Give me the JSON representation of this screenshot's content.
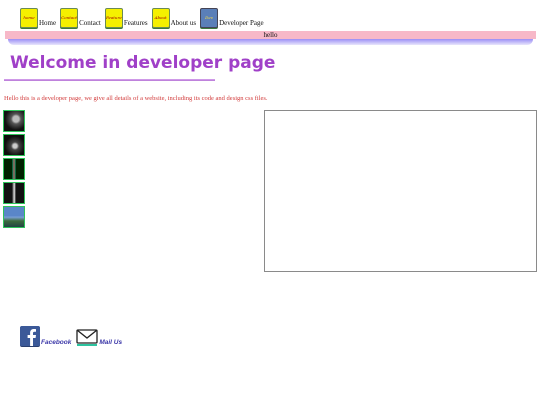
{
  "nav": [
    {
      "icon": "home-icon",
      "icon_text": "home",
      "label": "Home"
    },
    {
      "icon": "contact-icon",
      "icon_text": "Contact",
      "label": "Contact"
    },
    {
      "icon": "features-icon",
      "icon_text": "Feature",
      "label": "Features"
    },
    {
      "icon": "about-icon",
      "icon_text": "About",
      "label": "About us"
    },
    {
      "icon": "developer-icon",
      "icon_text": "Dev",
      "label": "Developer Page"
    }
  ],
  "banner": {
    "text": "hello"
  },
  "title": "Welcome in developer page",
  "intro": "Hello this is a developer page, we give all details of a website, including its code and design css files.",
  "thumbnails": [
    "thumbnail-1",
    "thumbnail-2",
    "thumbnail-3",
    "thumbnail-4",
    "thumbnail-5"
  ],
  "social": {
    "facebook": {
      "icon": "facebook-icon",
      "label": "Facebook"
    },
    "mail": {
      "icon": "mail-icon",
      "label": "Mail Us"
    }
  },
  "colors": {
    "title": "#a040c8",
    "intro": "#d23b3b",
    "banner": "#f7b8c8",
    "social_label": "#3b37a8",
    "facebook": "#3b5998"
  }
}
